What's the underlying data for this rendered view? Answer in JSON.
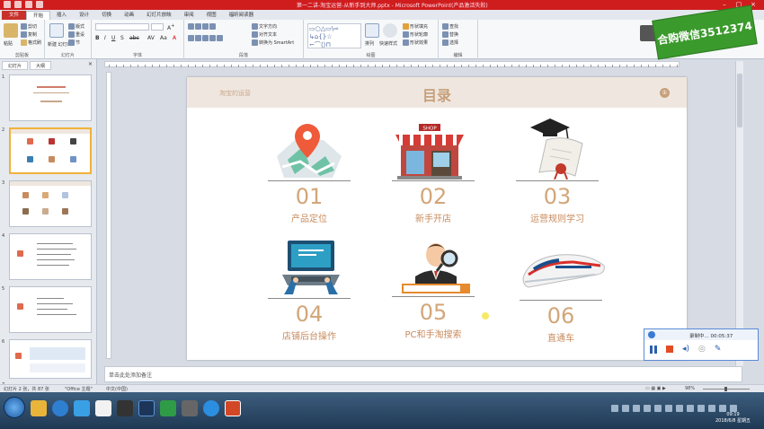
{
  "window": {
    "title": "第一二讲-淘宝运营-从新手到大师.pptx - Microsoft PowerPoint(产品激活失败)"
  },
  "ribbon_tabs": [
    "文件",
    "开始",
    "插入",
    "设计",
    "切换",
    "动画",
    "幻灯片放映",
    "审阅",
    "视图",
    "福昕阅读器"
  ],
  "ribbon": {
    "clipboard": {
      "paste": "粘贴",
      "cut": "剪切",
      "copy": "复制",
      "format": "格式刷",
      "label": "剪贴板"
    },
    "slides": {
      "new_slide": "新建\n幻灯片",
      "layout": "版式",
      "reset": "重设",
      "section": "节",
      "label": "幻灯片"
    },
    "font": {
      "label": "字体"
    },
    "paragraph": {
      "text_dir": "文字方向",
      "align_text": "对齐文本",
      "smartart": "转换为 SmartArt",
      "label": "段落"
    },
    "drawing": {
      "arrange": "排列",
      "quick_styles": "快速样式",
      "fill": "形状填充",
      "outline": "形状轮廓",
      "effects": "形状效果",
      "label": "绘图"
    },
    "editing": {
      "find": "查找",
      "replace": "替换",
      "select": "选择",
      "label": "编辑"
    }
  },
  "watermark": "合购微信3512374",
  "left_pane": {
    "tabs": [
      "幻灯片",
      "大纲"
    ],
    "close": "×",
    "thumbs": [
      {
        "num": "1",
        "selected": false
      },
      {
        "num": "2",
        "selected": true
      },
      {
        "num": "3",
        "selected": false
      },
      {
        "num": "4",
        "selected": false
      },
      {
        "num": "5",
        "selected": false
      },
      {
        "num": "6",
        "selected": false
      },
      {
        "num": "7",
        "selected": false
      }
    ]
  },
  "slide": {
    "subtitle": "淘宝的运营",
    "title": "目录",
    "badge": "①",
    "items": [
      {
        "num": "01",
        "label": "产品定位",
        "icon": "map-pin-icon"
      },
      {
        "num": "02",
        "label": "新手开店",
        "icon": "shop-icon"
      },
      {
        "num": "03",
        "label": "运营规则学习",
        "icon": "diploma-icon"
      },
      {
        "num": "04",
        "label": "店铺后台操作",
        "icon": "laptop-icon"
      },
      {
        "num": "05",
        "label": "PC和手淘搜索",
        "icon": "search-person-icon"
      },
      {
        "num": "06",
        "label": "直通车",
        "icon": "train-icon"
      }
    ]
  },
  "recorder": {
    "status": "录制中...",
    "time": "00:05:37"
  },
  "notes": {
    "placeholder": "单击此处添加备注"
  },
  "statusbar": {
    "slide_info": "幻灯片 2 张，共 87 张",
    "theme": "\"Office 主题\"",
    "lang": "中文(中国)",
    "zoom": "98%"
  },
  "taskbar": {
    "time": "09:19",
    "date": "2018/6/8 星期五"
  },
  "colors": {
    "accent_gold": "#d2a679",
    "title_red": "#cf1d1d",
    "watermark_green": "#3b9a2c"
  }
}
